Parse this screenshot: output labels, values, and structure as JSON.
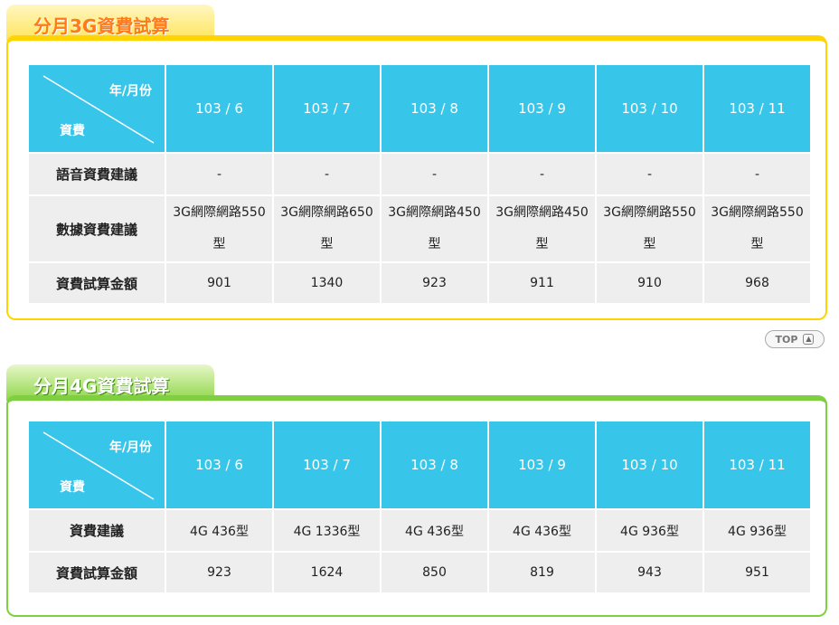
{
  "section_3g": {
    "title": "分月3G資費試算",
    "corner_top": "年/月份",
    "corner_bottom": "資費",
    "months": [
      "103 / 6",
      "103 / 7",
      "103 / 8",
      "103 / 9",
      "103 / 10",
      "103 / 11"
    ],
    "rows": [
      {
        "label": "語音資費建議",
        "values": [
          "-",
          "-",
          "-",
          "-",
          "-",
          "-"
        ]
      },
      {
        "label": "數據資費建議",
        "values": [
          "3G網際網路550型",
          "3G網際網路650型",
          "3G網際網路450型",
          "3G網際網路450型",
          "3G網際網路550型",
          "3G網際網路550型"
        ]
      },
      {
        "label": "資費試算金額",
        "values": [
          "901",
          "1340",
          "923",
          "911",
          "910",
          "968"
        ]
      }
    ]
  },
  "top_button": {
    "label": "TOP",
    "icon": "arrow-up-icon"
  },
  "section_4g": {
    "title": "分月4G資費試算",
    "corner_top": "年/月份",
    "corner_bottom": "資費",
    "months": [
      "103 / 6",
      "103 / 7",
      "103 / 8",
      "103 / 9",
      "103 / 10",
      "103 / 11"
    ],
    "rows": [
      {
        "label": "資費建議",
        "values": [
          "4G 436型",
          "4G 1336型",
          "4G 436型",
          "4G 436型",
          "4G 936型",
          "4G 936型"
        ]
      },
      {
        "label": "資費試算金額",
        "values": [
          "923",
          "1624",
          "850",
          "819",
          "943",
          "951"
        ]
      }
    ]
  },
  "colors": {
    "header_blue": "#38c5ea",
    "yellow_border": "#ffd400",
    "green_border": "#7fd040",
    "cell_bg": "#eeeeee"
  }
}
